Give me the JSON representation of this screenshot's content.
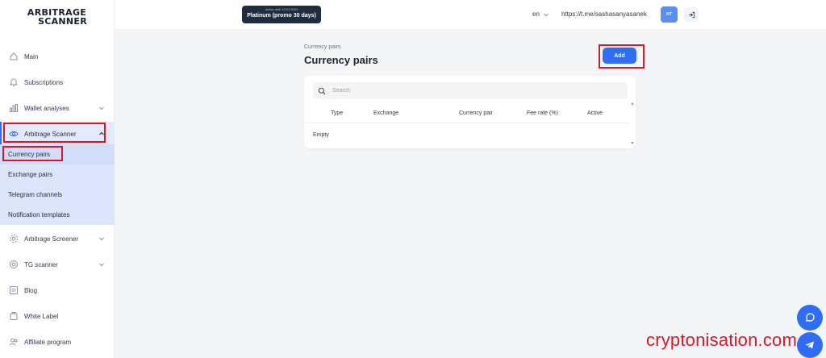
{
  "app": {
    "logo_line1": "ARBITRAGE",
    "logo_line2": "SCANNER"
  },
  "topbar": {
    "badge_small": "Active until 19.01.2024",
    "badge_main": "Platinum (promo 30 days)",
    "language": "en",
    "telegram_link": "https://t.me/sashasanyasanek",
    "avatar_initials": "НТ"
  },
  "sidebar": {
    "items": [
      {
        "label": "Main",
        "icon": "home-icon"
      },
      {
        "label": "Subscriptions",
        "icon": "bell-icon"
      },
      {
        "label": "Wallet analyses",
        "icon": "chart-bars-icon"
      },
      {
        "label": "Arbitrage Scanner",
        "icon": "eye-icon"
      },
      {
        "label": "Arbitrage Screener",
        "icon": "gear-icon"
      },
      {
        "label": "TG scanner",
        "icon": "radar-icon"
      },
      {
        "label": "Blog",
        "icon": "blog-icon"
      },
      {
        "label": "White Label",
        "icon": "wallet-icon"
      },
      {
        "label": "Affiliate program",
        "icon": "users-icon"
      }
    ],
    "subitems": [
      {
        "label": "Currency pairs"
      },
      {
        "label": "Exchange pairs"
      },
      {
        "label": "Telegram channels"
      },
      {
        "label": "Notification templates"
      }
    ]
  },
  "main": {
    "breadcrumb": "Currency pairs",
    "title": "Currency pairs",
    "add_label": "Add",
    "search_placeholder": "Search",
    "columns": [
      "Type",
      "Exchange",
      "Currency pair",
      "Fee rate (%)",
      "Active"
    ],
    "empty_text": "Empty"
  },
  "watermark": "cryptonisation.com",
  "colors": {
    "accent": "#2f6df6",
    "highlight": "#d7182a",
    "badge_bg": "#1f2c3d",
    "active_nav_bg": "#e4eafb"
  }
}
